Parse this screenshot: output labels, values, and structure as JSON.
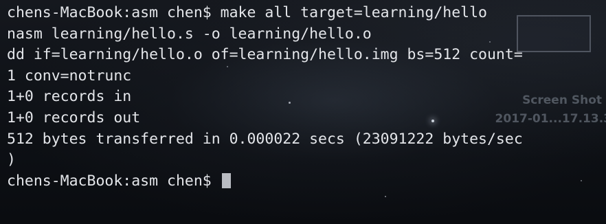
{
  "terminal": {
    "lines": [
      "chens-MacBook:asm chen$ make all target=learning/hello",
      "nasm learning/hello.s -o learning/hello.o",
      "dd if=learning/hello.o of=learning/hello.img bs=512 count=",
      "1 conv=notrunc",
      "1+0 records in",
      "1+0 records out",
      "512 bytes transferred in 0.000022 secs (23091222 bytes/sec",
      ")"
    ],
    "prompt": "chens-MacBook:asm chen$ "
  },
  "desktop": {
    "file_name_line1": "Screen Shot",
    "file_name_line2": "2017-01...17.13.3"
  }
}
